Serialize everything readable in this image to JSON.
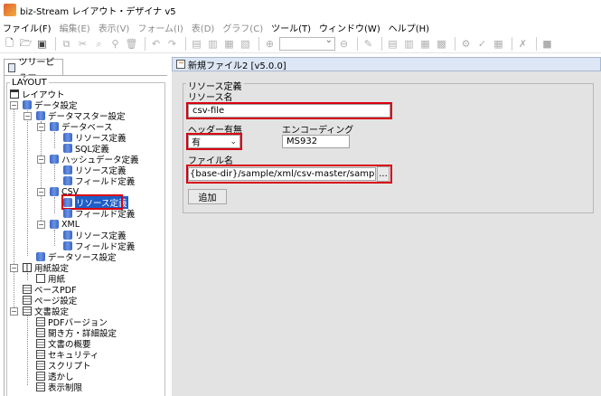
{
  "window": {
    "title": "biz-Stream レイアウト・デザイナ v5"
  },
  "menu": [
    {
      "label": "ファイル(F)",
      "disabled": false
    },
    {
      "label": "編集(E)",
      "disabled": true
    },
    {
      "label": "表示(V)",
      "disabled": true
    },
    {
      "label": "フォーム(I)",
      "disabled": true
    },
    {
      "label": "表(D)",
      "disabled": true
    },
    {
      "label": "グラフ(C)",
      "disabled": true
    },
    {
      "label": "ツール(T)",
      "disabled": false
    },
    {
      "label": "ウィンドウ(W)",
      "disabled": false
    },
    {
      "label": "ヘルプ(H)",
      "disabled": false
    }
  ],
  "left_panel": {
    "tab_label": "ツリービュー",
    "legend": "LAYOUT",
    "tree": {
      "root": "レイアウト",
      "data_settings": "データ設定",
      "data_master": "データマスター設定",
      "database": "データベース",
      "db_resource": "リソース定義",
      "db_sql": "SQL定義",
      "hash": "ハッシュデータ定義",
      "hash_resource": "リソース定義",
      "hash_field": "フィールド定義",
      "csv": "CSV",
      "csv_resource": "リソース定義",
      "csv_field": "フィールド定義",
      "xml": "XML",
      "xml_resource": "リソース定義",
      "xml_field": "フィールド定義",
      "datasource": "データソース設定",
      "paper_settings": "用紙設定",
      "paper": "用紙",
      "base_pdf": "ベースPDF",
      "page_settings": "ページ設定",
      "doc_settings": "文書設定",
      "pdf_version": "PDFバージョン",
      "open_detail": "開き方・詳細設定",
      "doc_summary": "文書の概要",
      "security": "セキュリティ",
      "script": "スクリプト",
      "watermark": "透かし",
      "display_limit": "表示制限"
    }
  },
  "editor": {
    "tab_title": "新規ファイル2 [v5.0.0]",
    "fieldset_legend": "リソース定義",
    "resource_name_label": "リソース名",
    "resource_name_value": "csv-file",
    "header_label": "ヘッダー有無",
    "header_value": "有",
    "encoding_label": "エンコーディング",
    "encoding_value": "MS932",
    "filename_label": "ファイル名",
    "filename_value": "{base-dir}/sample/xml/csv-master/sample.csv",
    "browse_label": "...",
    "add_label": "追加"
  }
}
